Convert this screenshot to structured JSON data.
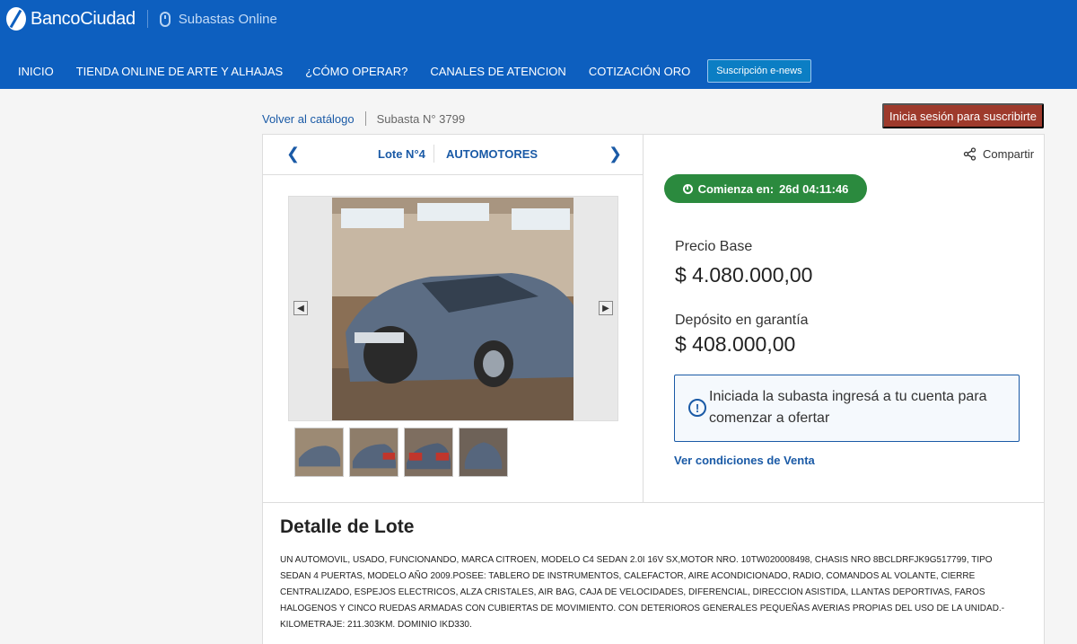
{
  "brand": {
    "name": "BancoCiudad",
    "section": "Subastas Online"
  },
  "nav": {
    "items": [
      {
        "label": "INICIO"
      },
      {
        "label": "TIENDA ONLINE DE ARTE Y ALHAJAS"
      },
      {
        "label": "¿CÓMO OPERAR?"
      },
      {
        "label": "CANALES DE ATENCION"
      },
      {
        "label": "COTIZACIÓN ORO"
      }
    ],
    "newsletter": "Suscripción e-news"
  },
  "breadcrumb": {
    "back": "Volver al catálogo",
    "current": "Subasta N° 3799"
  },
  "login_button": "Inicia sesión para suscribirte",
  "lot": {
    "number": "Lote N°4",
    "category": "AUTOMOTORES"
  },
  "share": "Compartir",
  "countdown": {
    "label": "Comienza en:",
    "value": "26d 04:11:46"
  },
  "price": {
    "label": "Precio Base",
    "value": "$ 4.080.000,00"
  },
  "deposit": {
    "label": "Depósito en garantía",
    "value": "$ 408.000,00"
  },
  "info": "Iniciada la subasta ingresá a tu cuenta para comenzar a ofertar",
  "conditions_link": "Ver condiciones de Venta",
  "detail": {
    "title": "Detalle de Lote",
    "text": "UN AUTOMOVIL, USADO, FUNCIONANDO, MARCA CITROEN, MODELO C4 SEDAN 2.0I 16V SX,MOTOR NRO. 10TW020008498, CHASIS NRO 8BCLDRFJK9G517799, TIPO SEDAN 4 PUERTAS, MODELO AÑO 2009.POSEE: TABLERO DE INSTRUMENTOS, CALEFACTOR, AIRE ACONDICIONADO, RADIO, COMANDOS AL VOLANTE, CIERRE CENTRALIZADO, ESPEJOS ELECTRICOS, ALZA CRISTALES, AIR BAG, CAJA DE VELOCIDADES, DIFERENCIAL, DIRECCION ASISTIDA, LLANTAS DEPORTIVAS, FAROS HALOGENOS Y CINCO RUEDAS ARMADAS CON CUBIERTAS DE MOVIMIENTO. CON DETERIOROS GENERALES PEQUEÑAS AVERIAS PROPIAS DEL USO DE LA UNIDAD.- KILOMETRAJE: 211.303KM. DOMINIO IKD330."
  },
  "colors": {
    "header": "#0d5fbf",
    "link": "#1a5aa6",
    "login": "#9e3a2c",
    "countdown": "#2b8a3e"
  },
  "icons": [
    "mouse-icon",
    "chevron-left-icon",
    "chevron-right-icon",
    "share-icon",
    "clock-icon",
    "info-icon"
  ]
}
